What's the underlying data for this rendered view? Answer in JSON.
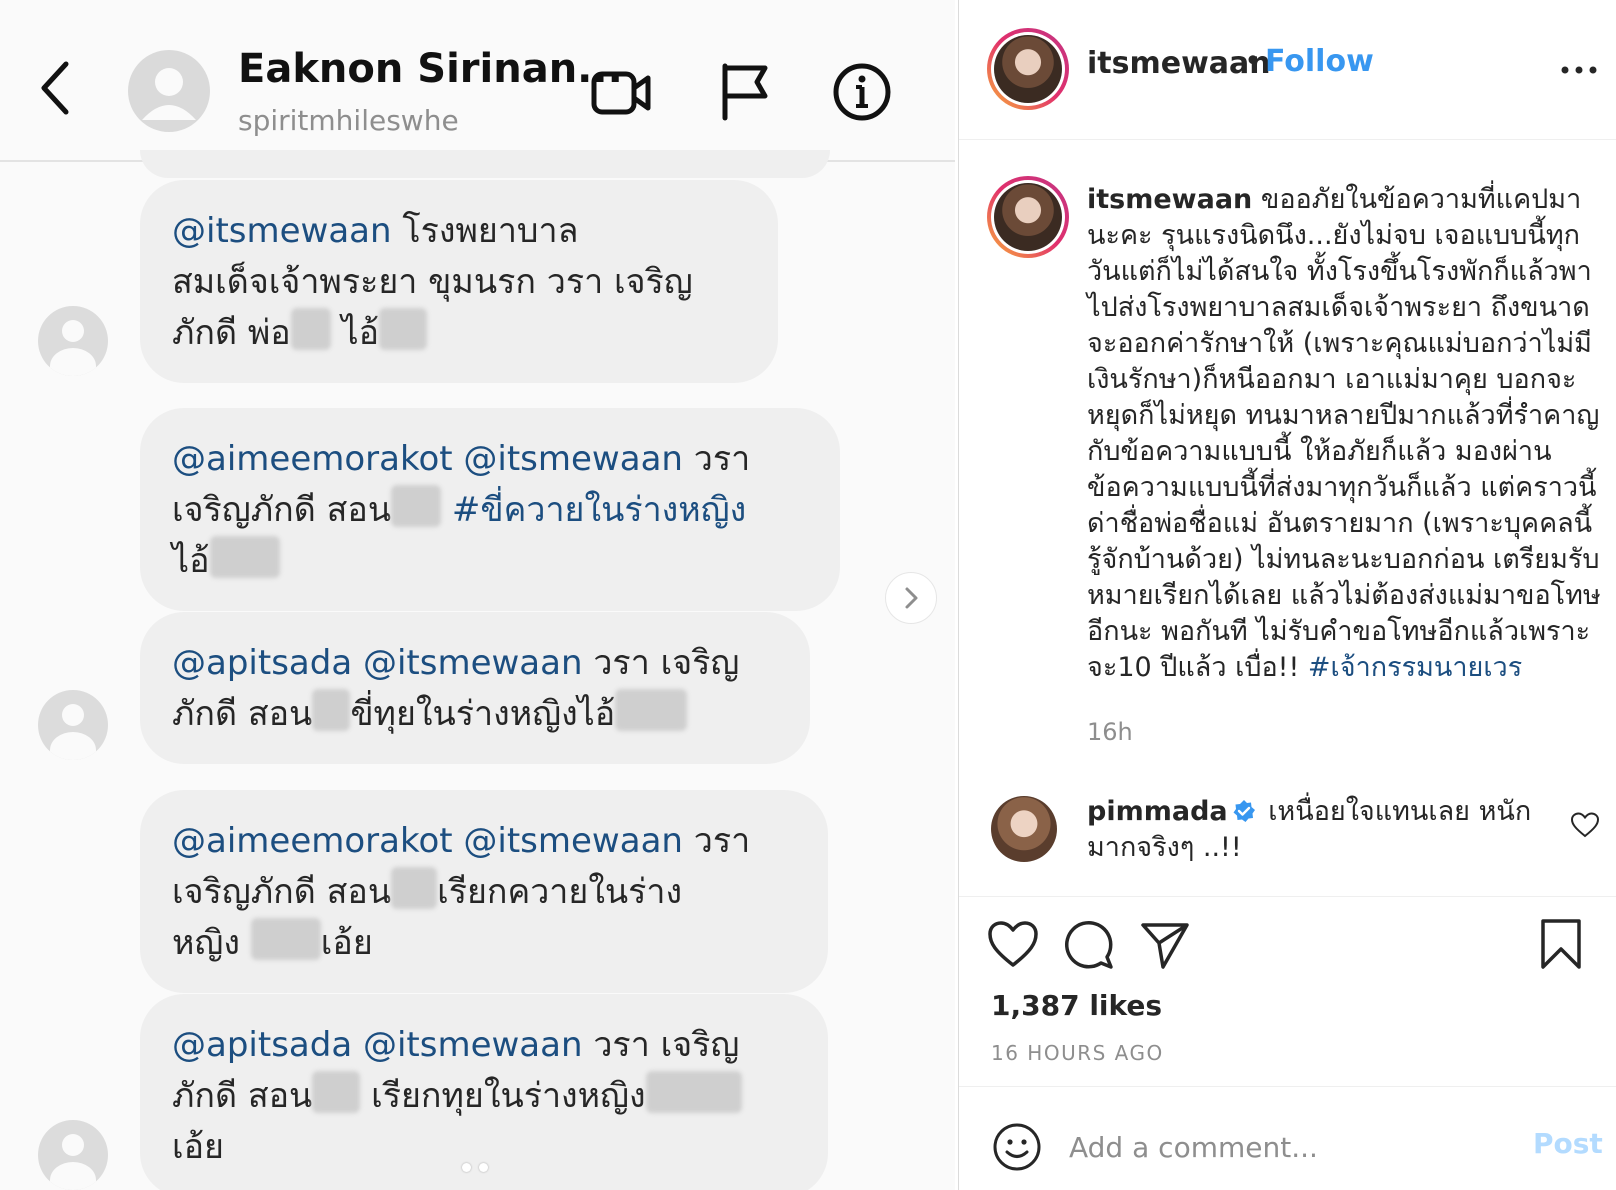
{
  "dm": {
    "contact_name": "Eaknon Sirinan...",
    "contact_username": "spiritmhileswhe",
    "messages": [
      {
        "lines": [
          [
            {
              "t": "mention",
              "v": "@itsmewaan"
            },
            {
              "t": "text",
              "v": " โรงพยาบาล"
            }
          ],
          [
            {
              "t": "text",
              "v": "สมเด็จเจ้าพระยา ขุมนรก วรา เจริญ"
            }
          ],
          [
            {
              "t": "text",
              "v": "ภักดี พ่อ"
            },
            {
              "t": "blur",
              "w": 40
            },
            {
              "t": "text",
              "v": " ไอ้"
            },
            {
              "t": "blur",
              "w": 48
            }
          ]
        ]
      },
      {
        "lines": [
          [
            {
              "t": "mention",
              "v": "@aimeemorakot @itsmewaan"
            },
            {
              "t": "text",
              "v": " วรา"
            }
          ],
          [
            {
              "t": "text",
              "v": "เจริญภักดี สอน"
            },
            {
              "t": "blur",
              "w": 50
            },
            {
              "t": "text",
              "v": " "
            },
            {
              "t": "mention",
              "v": "#ขี่ควายในร่างหญิง"
            }
          ],
          [
            {
              "t": "text",
              "v": "ไอ้"
            },
            {
              "t": "blur",
              "w": 70
            }
          ]
        ]
      },
      {
        "lines": [
          [
            {
              "t": "mention",
              "v": "@apitsada @itsmewaan"
            },
            {
              "t": "text",
              "v": " วรา เจริญ"
            }
          ],
          [
            {
              "t": "text",
              "v": "ภักดี สอน"
            },
            {
              "t": "blur",
              "w": 38
            },
            {
              "t": "text",
              "v": "ขี่ทุยในร่างหญิงไอ้"
            },
            {
              "t": "blur",
              "w": 72
            }
          ]
        ]
      },
      {
        "lines": [
          [
            {
              "t": "mention",
              "v": "@aimeemorakot @itsmewaan"
            },
            {
              "t": "text",
              "v": " วรา"
            }
          ],
          [
            {
              "t": "text",
              "v": "เจริญภักดี สอน"
            },
            {
              "t": "blur",
              "w": 46
            },
            {
              "t": "text",
              "v": "เรียกควายในร่าง"
            }
          ],
          [
            {
              "t": "text",
              "v": "หญิง "
            },
            {
              "t": "blur",
              "w": 70
            },
            {
              "t": "text",
              "v": "เอ้ย"
            }
          ]
        ]
      },
      {
        "lines": [
          [
            {
              "t": "mention",
              "v": "@apitsada @itsmewaan"
            },
            {
              "t": "text",
              "v": " วรา เจริญ"
            }
          ],
          [
            {
              "t": "text",
              "v": "ภักดี สอน"
            },
            {
              "t": "blur",
              "w": 48
            },
            {
              "t": "text",
              "v": " เรียกทุยในร่างหญิง"
            },
            {
              "t": "blur",
              "w": 96
            }
          ],
          [
            {
              "t": "text",
              "v": "เอ้ย"
            }
          ]
        ]
      }
    ]
  },
  "post": {
    "username": "itsmewaan",
    "separator": "•",
    "follow_label": "Follow",
    "caption_user": "itsmewaan",
    "caption_text": " ขออภัยในข้อความที่แคปมานะคะ รุนแรงนิดนึง...ยังไม่จบ เจอแบบนี้ทุกวันแต่ก็ไม่ได้สนใจ ทั้งโรงขึ้นโรงพักก็แล้วพาไปส่งโรงพยาบาลสมเด็จเจ้าพระยา ถึงขนาดจะออกค่ารักษาให้ (เพราะคุณแม่บอกว่าไม่มีเงินรักษา)ก็หนีออกมา เอาแม่มาคุย บอกจะหยุดก็ไม่หยุด ทนมาหลายปีมากแล้วที่รำคาญกับข้อความแบบนี้ ให้อภัยก็แล้ว มองผ่านข้อความแบบนี้ที่ส่งมาทุกวันก็แล้ว แต่คราวนี้ด่าชื่อพ่อชื่อแม่ อันตรายมาก (เพราะบุคคลนี้รู้จักบ้านด้วย) ไม่ทนละนะบอกก่อน เตรียมรับหมายเรียกได้เลย แล้วไม่ต้องส่งแม่มาขอโทษอีกนะ พอกันที ไม่รับคำขอโทษอีกแล้วเพราะจะ10 ปีแล้ว เบื่อ!! ",
    "caption_hashtag": "#เจ้ากรรมนายเวร",
    "caption_time": "16h",
    "comment_user": "pimmada",
    "comment_text": " เหนื่อยใจแทนเลย หนักมากจริงๆ ..!!",
    "likes": "1,387 likes",
    "time_ago": "16 HOURS AGO",
    "comment_placeholder": "Add a comment...",
    "post_label": "Post"
  },
  "icons": {
    "back": "chevron-left-icon",
    "video": "video-camera-icon",
    "report": "flag-icon",
    "info": "info-icon",
    "next": "chevron-right-icon",
    "more": "more-horizontal-icon",
    "verified": "verified-badge-icon",
    "comment_like": "heart-icon",
    "like": "heart-icon",
    "comment": "comment-bubble-icon",
    "share": "paper-plane-icon",
    "save": "bookmark-icon",
    "emoji": "smiley-icon"
  },
  "colors": {
    "mention": "#1c4e80",
    "follow": "#3897f0",
    "post_disabled": "#b3dbff",
    "bubble": "#efefef",
    "verified": "#3897f0"
  }
}
